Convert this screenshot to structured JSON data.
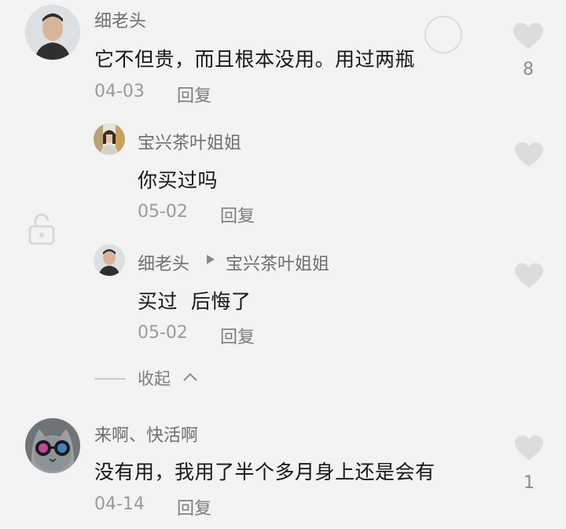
{
  "comments": [
    {
      "username": "细老头",
      "content": "它不但贵，而且根本没用。用过两瓶",
      "date": "04-03",
      "reply_label": "回复",
      "likes": "8",
      "replies": [
        {
          "username": "宝兴茶叶姐姐",
          "content": "你买过吗",
          "date": "05-02",
          "reply_label": "回复"
        },
        {
          "username": "细老头",
          "reply_to": "宝兴茶叶姐姐",
          "content": "买过  后悔了",
          "date": "05-02",
          "reply_label": "回复"
        }
      ],
      "collapse_label": "收起"
    },
    {
      "username": "来啊、快活啊",
      "content": "没有用，我用了半个多月身上还是会有",
      "date": "04-14",
      "reply_label": "回复",
      "likes": "1"
    }
  ],
  "icons": {
    "like": "heart-icon",
    "arrow": "triangle-right-icon",
    "collapse_chevron": "chevron-up-icon",
    "overlay_lock": "unlock-icon"
  },
  "colors": {
    "background": "#f3f3f3",
    "heart": "#dcdcdc",
    "username": "#6e6e6e",
    "meta": "#9a9a9a"
  }
}
